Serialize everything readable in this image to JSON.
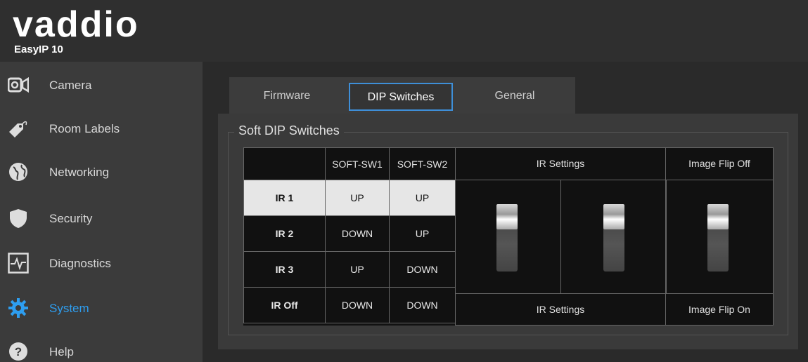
{
  "header": {
    "logo_text": "vaddio",
    "product_name": "EasyIP 10"
  },
  "sidebar": {
    "items": [
      {
        "label": "Camera",
        "icon": "camera-icon"
      },
      {
        "label": "Room Labels",
        "icon": "tag-icon"
      },
      {
        "label": "Networking",
        "icon": "globe-icon"
      },
      {
        "label": "Security",
        "icon": "shield-icon"
      },
      {
        "label": "Diagnostics",
        "icon": "pulse-icon"
      },
      {
        "label": "System",
        "icon": "gear-icon",
        "active": true
      },
      {
        "label": "Help",
        "icon": "help-icon"
      }
    ]
  },
  "tabs": [
    {
      "label": "Firmware"
    },
    {
      "label": "DIP Switches",
      "active": true
    },
    {
      "label": "General"
    }
  ],
  "panel": {
    "legend": "Soft DIP Switches",
    "table": {
      "headers": [
        "",
        "SOFT-SW1",
        "SOFT-SW2"
      ],
      "rows": [
        {
          "label": "IR 1",
          "sw1": "UP",
          "sw2": "UP",
          "highlight": true
        },
        {
          "label": "IR 2",
          "sw1": "DOWN",
          "sw2": "UP"
        },
        {
          "label": "IR 3",
          "sw1": "UP",
          "sw2": "DOWN"
        },
        {
          "label": "IR Off",
          "sw1": "DOWN",
          "sw2": "DOWN"
        }
      ]
    },
    "ir_settings_top": "IR Settings",
    "ir_settings_bottom": "IR Settings",
    "image_flip_top": "Image Flip Off",
    "image_flip_bottom": "Image Flip On"
  },
  "colors": {
    "accent": "#2e9ef0",
    "tab_border": "#3e8fd8",
    "highlight_row": "#e6e6e6"
  }
}
